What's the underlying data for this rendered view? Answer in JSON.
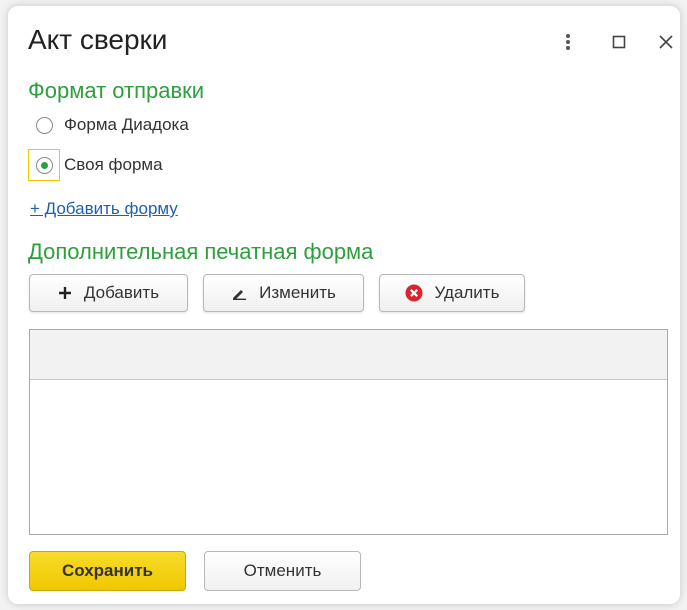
{
  "window": {
    "title": "Акт сверки"
  },
  "send_format": {
    "label": "Формат отправки",
    "options": [
      {
        "label": "Форма Диадока",
        "selected": false
      },
      {
        "label": "Своя форма",
        "selected": true
      }
    ],
    "add_link": "+ Добавить форму"
  },
  "extra_print": {
    "label": "Дополнительная печатная форма",
    "add_label": "Добавить",
    "edit_label": "Изменить",
    "delete_label": "Удалить"
  },
  "footer": {
    "save_label": "Сохранить",
    "cancel_label": "Отменить"
  },
  "colors": {
    "accent_green": "#2d9f3c",
    "save_yellow": "#f5d31a",
    "delete_red": "#d9262e",
    "link_blue": "#1c5fb3"
  }
}
